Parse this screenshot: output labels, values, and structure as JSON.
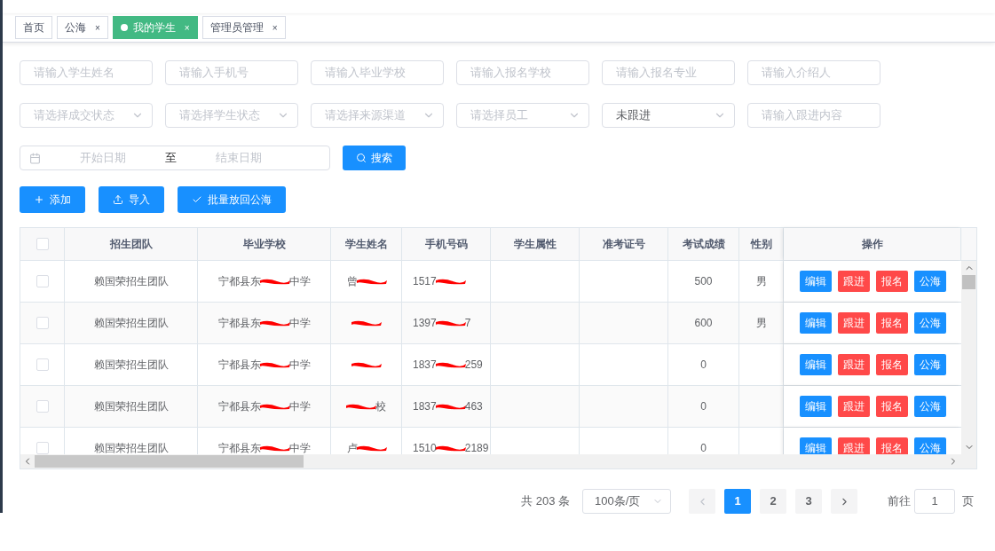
{
  "tabs": [
    {
      "label": "首页",
      "selected": false
    },
    {
      "label": "公海",
      "close": "×",
      "selected": false
    },
    {
      "label": "我的学生",
      "close": "×",
      "selected": true
    },
    {
      "label": "管理员管理",
      "close": "×",
      "selected": false
    }
  ],
  "filters": [
    [
      {
        "kind": "input",
        "placeholder": "请输入学生姓名"
      },
      {
        "kind": "input",
        "placeholder": "请输入手机号"
      },
      {
        "kind": "input",
        "placeholder": "请输入毕业学校"
      },
      {
        "kind": "input",
        "placeholder": "请输入报名学校"
      },
      {
        "kind": "input",
        "placeholder": "请输入报名专业"
      },
      {
        "kind": "input",
        "placeholder": "请输入介绍人"
      }
    ],
    [
      {
        "kind": "select",
        "placeholder": "请选择成交状态"
      },
      {
        "kind": "select",
        "placeholder": "请选择学生状态"
      },
      {
        "kind": "select",
        "placeholder": "请选择来源渠道"
      },
      {
        "kind": "select",
        "placeholder": "请选择员工"
      },
      {
        "kind": "select",
        "value": "未跟进"
      },
      {
        "kind": "input",
        "placeholder": "请输入跟进内容"
      }
    ]
  ],
  "date_range": {
    "start_placeholder": "开始日期",
    "separator": "至",
    "end_placeholder": "结束日期"
  },
  "search_button": "搜索",
  "actions": [
    {
      "kind": "plus",
      "label": "添加"
    },
    {
      "kind": "upload",
      "label": "导入"
    },
    {
      "kind": "check",
      "label": "批量放回公海"
    }
  ],
  "table": {
    "header_checked": false,
    "columns": [
      "招生团队",
      "毕业学校",
      "学生姓名",
      "手机号码",
      "学生属性",
      "准考证号",
      "考试成绩",
      "性别",
      "操作"
    ],
    "rows": [
      {
        "checked": false,
        "team": "赖国荣招生团队",
        "school_pre": "宁都县东",
        "school_post": "中学",
        "name_pre": "曾",
        "phone_pre": "1517",
        "score": "500",
        "gender": "男",
        "actions": [
          {
            "label": "编辑",
            "kind": "primary"
          },
          {
            "label": "跟进",
            "kind": "danger"
          },
          {
            "label": "报名",
            "kind": "danger"
          },
          {
            "label": "公海",
            "kind": "primary"
          }
        ]
      },
      {
        "checked": false,
        "team": "赖国荣招生团队",
        "school_pre": "宁都县东",
        "school_post": "中学",
        "phone_pre": "1397",
        "phone_post": "7",
        "score": "600",
        "gender": "男",
        "actions": [
          {
            "label": "编辑",
            "kind": "primary"
          },
          {
            "label": "跟进",
            "kind": "danger"
          },
          {
            "label": "报名",
            "kind": "danger"
          },
          {
            "label": "公海",
            "kind": "primary"
          }
        ]
      },
      {
        "checked": false,
        "team": "赖国荣招生团队",
        "school_pre": "宁都县东",
        "school_post": "中学",
        "phone_pre": "1837",
        "phone_post": "259",
        "score": "0",
        "actions": [
          {
            "label": "编辑",
            "kind": "primary"
          },
          {
            "label": "跟进",
            "kind": "danger"
          },
          {
            "label": "报名",
            "kind": "danger"
          },
          {
            "label": "公海",
            "kind": "primary"
          }
        ]
      },
      {
        "checked": false,
        "team": "赖国荣招生团队",
        "school_pre": "宁都县东",
        "school_post": "中学",
        "name_post": "校",
        "phone_pre": "1837",
        "phone_post": "463",
        "score": "0",
        "actions": [
          {
            "label": "编辑",
            "kind": "primary"
          },
          {
            "label": "跟进",
            "kind": "danger"
          },
          {
            "label": "报名",
            "kind": "danger"
          },
          {
            "label": "公海",
            "kind": "primary"
          }
        ]
      },
      {
        "checked": false,
        "team": "赖国荣招生团队",
        "school_pre": "宁都县东",
        "school_post": "中学",
        "name_pre": "卢",
        "phone_pre": "1510",
        "phone_post": "2189",
        "score": "0",
        "actions": [
          {
            "label": "编辑",
            "kind": "primary"
          },
          {
            "label": "跟进",
            "kind": "danger"
          },
          {
            "label": "报名",
            "kind": "danger"
          },
          {
            "label": "公海",
            "kind": "primary"
          }
        ]
      }
    ]
  },
  "pagination": {
    "total": "共 203 条",
    "page_size": "100条/页",
    "pages": [
      {
        "label": "1",
        "selected": true
      },
      {
        "label": "2",
        "selected": false
      },
      {
        "label": "3",
        "selected": false
      }
    ],
    "goto_label": "前往",
    "goto_value": "1",
    "goto_suffix": "页"
  }
}
